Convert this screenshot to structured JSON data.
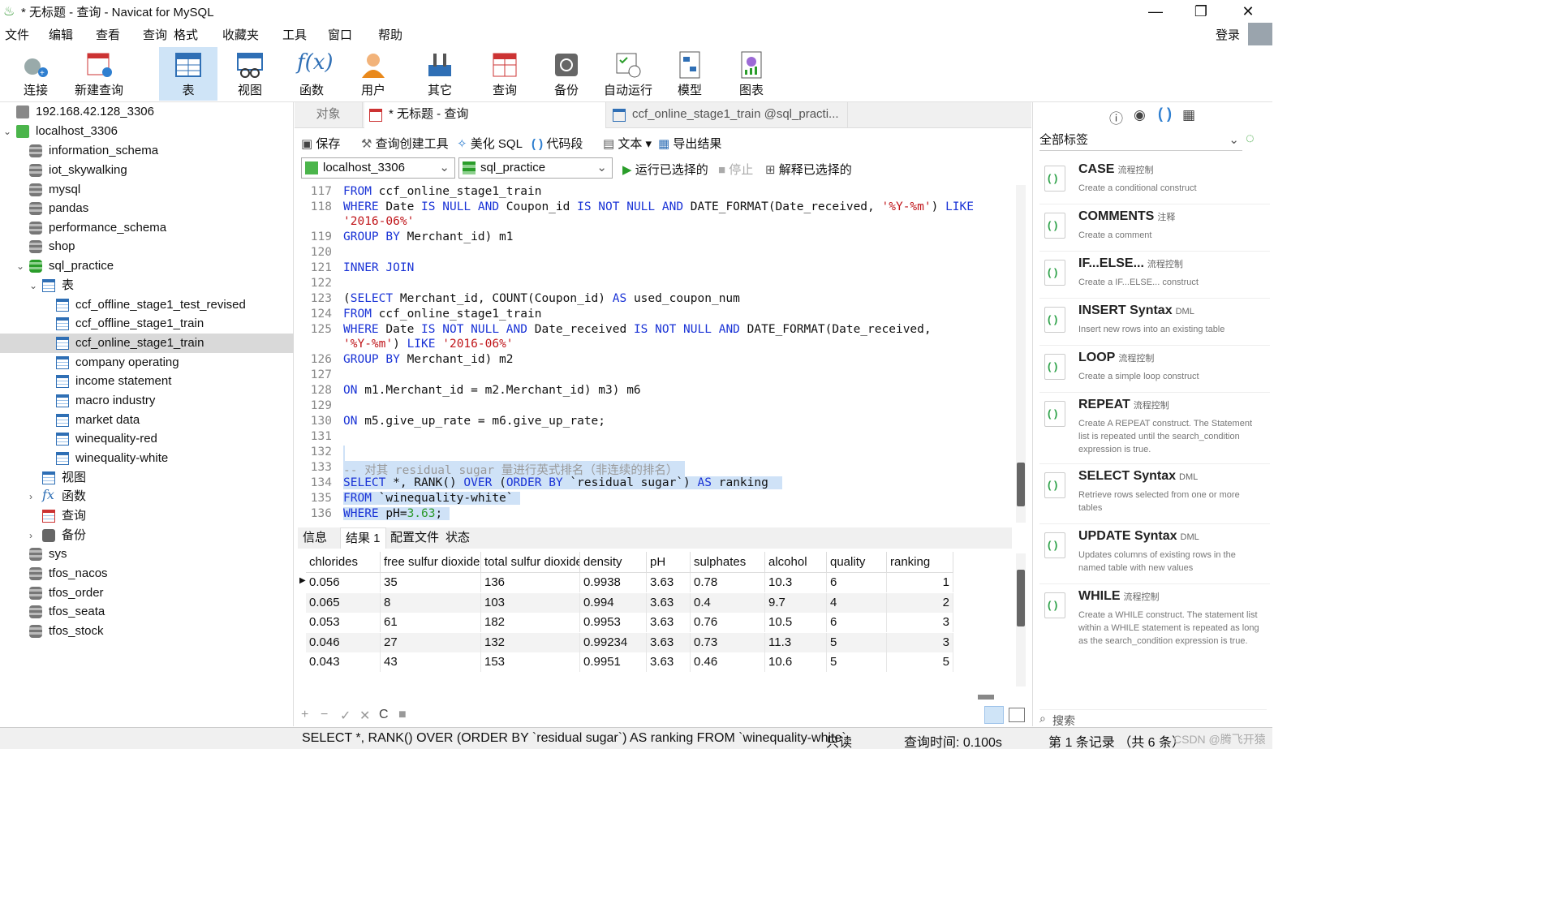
{
  "titlebar": {
    "title": "* 无标题 - 查询 - Navicat for MySQL",
    "minimize": "—",
    "maximize": "❐",
    "close": "✕"
  },
  "menu": {
    "items": [
      "文件",
      "编辑",
      "查看",
      "查询",
      "格式",
      "收藏夹",
      "工具",
      "窗口",
      "帮助"
    ],
    "login": "登录"
  },
  "toolbar": {
    "items": [
      "连接",
      "新建查询",
      "表",
      "视图",
      "函数",
      "用户",
      "其它",
      "查询",
      "备份",
      "自动运行",
      "模型",
      "图表"
    ]
  },
  "tree": [
    {
      "label": "192.168.42.128_3306",
      "icon": "connection-gray"
    },
    {
      "label": "localhost_3306",
      "icon": "connection-green"
    },
    {
      "label": "information_schema",
      "icon": "database"
    },
    {
      "label": "iot_skywalking",
      "icon": "database"
    },
    {
      "label": "mysql",
      "icon": "database"
    },
    {
      "label": "pandas",
      "icon": "database"
    },
    {
      "label": "performance_schema",
      "icon": "database"
    },
    {
      "label": "shop",
      "icon": "database"
    },
    {
      "label": "sql_practice",
      "icon": "database-open"
    },
    {
      "label": "表",
      "icon": "table-folder"
    },
    {
      "label": "ccf_offline_stage1_test_revised",
      "icon": "table"
    },
    {
      "label": "ccf_offline_stage1_train",
      "icon": "table"
    },
    {
      "label": "ccf_online_stage1_train",
      "icon": "table"
    },
    {
      "label": "company operating",
      "icon": "table"
    },
    {
      "label": "income statement",
      "icon": "table"
    },
    {
      "label": "macro industry",
      "icon": "table"
    },
    {
      "label": "market data",
      "icon": "table"
    },
    {
      "label": "winequality-red",
      "icon": "table"
    },
    {
      "label": "winequality-white",
      "icon": "table"
    },
    {
      "label": "视图",
      "icon": "view"
    },
    {
      "label": "函数",
      "icon": "function"
    },
    {
      "label": "查询",
      "icon": "query"
    },
    {
      "label": "备份",
      "icon": "backup"
    },
    {
      "label": "sys",
      "icon": "database"
    },
    {
      "label": "tfos_nacos",
      "icon": "database"
    },
    {
      "label": "tfos_order",
      "icon": "database"
    },
    {
      "label": "tfos_seata",
      "icon": "database"
    },
    {
      "label": "tfos_stock",
      "icon": "database"
    }
  ],
  "tabs": {
    "objects": "对象",
    "query": "* 无标题 - 查询",
    "table": "ccf_online_stage1_train @sql_practi..."
  },
  "querytools": {
    "save": "保存",
    "builder": "查询创建工具",
    "beautify": "美化 SQL",
    "snippet": "代码段",
    "text": "文本",
    "export": "导出结果"
  },
  "querytools2": {
    "connection": "localhost_3306",
    "database": "sql_practice",
    "run_selected": "运行已选择的",
    "stop": "停止",
    "explain": "解释已选择的"
  },
  "editor": {
    "line_numbers": [
      "117",
      "118",
      "",
      "119",
      "120",
      "121",
      "122",
      "123",
      "124",
      "125",
      "",
      "126",
      "127",
      "128",
      "129",
      "130",
      "131",
      "132",
      "133",
      "134",
      "135",
      "136"
    ]
  },
  "result_tabs": [
    "信息",
    "结果 1",
    "配置文件",
    "状态"
  ],
  "grid": {
    "columns": [
      "chlorides",
      "free sulfur dioxide",
      "total sulfur dioxide",
      "density",
      "pH",
      "sulphates",
      "alcohol",
      "quality",
      "ranking"
    ],
    "rows": [
      [
        "0.056",
        "35",
        "136",
        "0.9938",
        "3.63",
        "0.78",
        "10.3",
        "6",
        "1"
      ],
      [
        "0.065",
        "8",
        "103",
        "0.994",
        "3.63",
        "0.4",
        "9.7",
        "4",
        "2"
      ],
      [
        "0.053",
        "61",
        "182",
        "0.9953",
        "3.63",
        "0.76",
        "10.5",
        "6",
        "3"
      ],
      [
        "0.046",
        "27",
        "132",
        "0.99234",
        "3.63",
        "0.73",
        "11.3",
        "5",
        "3"
      ],
      [
        "0.043",
        "43",
        "153",
        "0.9951",
        "3.63",
        "0.46",
        "10.6",
        "5",
        "5"
      ]
    ]
  },
  "bottom_icons": [
    "+",
    "−",
    "✓",
    "✕",
    "C",
    "■"
  ],
  "status": {
    "sql": "SELECT *, RANK() OVER (ORDER BY `residual sugar`) AS ranking  FROM `winequality-white`",
    "readonly": "只读",
    "time": "查询时间: 0.100s",
    "records": "第 1 条记录 （共 6 条）",
    "watermark": "CSDN @腾飞开猿"
  },
  "right": {
    "filter": "全部标签",
    "search_placeholder": "搜索",
    "snippets": [
      {
        "title": "CASE",
        "cat": "流程控制",
        "desc": "Create a conditional construct"
      },
      {
        "title": "COMMENTS",
        "cat": "注释",
        "desc": "Create a comment"
      },
      {
        "title": "IF...ELSE...",
        "cat": "流程控制",
        "desc": "Create a IF...ELSE... construct"
      },
      {
        "title": "INSERT Syntax",
        "cat": "DML",
        "desc": "Insert new rows into an existing table"
      },
      {
        "title": "LOOP",
        "cat": "流程控制",
        "desc": "Create a simple loop construct"
      },
      {
        "title": "REPEAT",
        "cat": "流程控制",
        "desc": "Create A REPEAT construct. The Statement list is repeated until the search_condition expression is true."
      },
      {
        "title": "SELECT Syntax",
        "cat": "DML",
        "desc": "Retrieve rows selected from one or more tables"
      },
      {
        "title": "UPDATE Syntax",
        "cat": "DML",
        "desc": "Updates columns of existing rows in the named table with new values"
      },
      {
        "title": "WHILE",
        "cat": "流程控制",
        "desc": "Create a WHILE construct. The statement list within a WHILE statement is repeated as long as the search_condition expression is true."
      }
    ]
  }
}
